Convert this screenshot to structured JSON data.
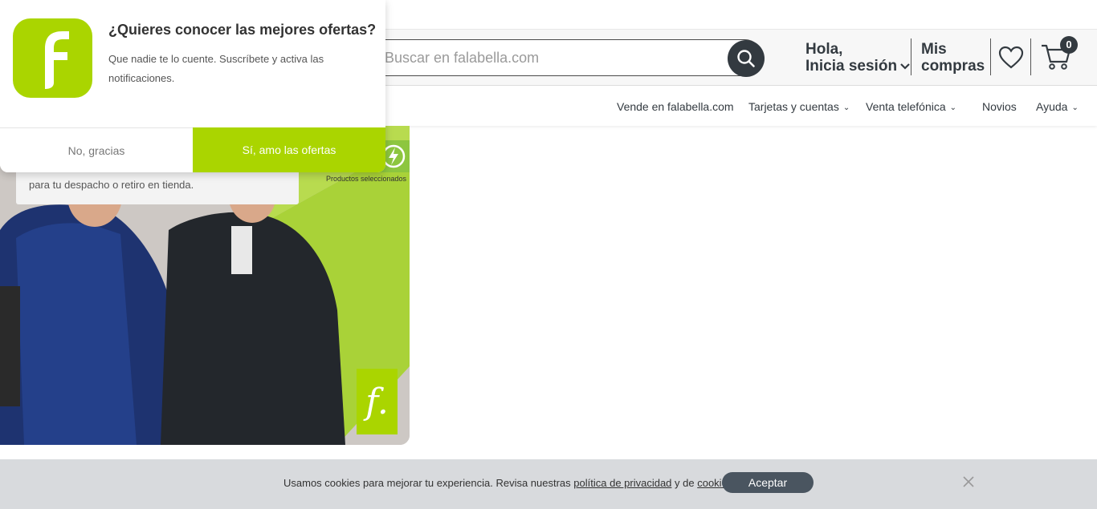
{
  "search": {
    "placeholder": "Buscar en falabella.com"
  },
  "account": {
    "greeting": "Hola,",
    "login_label": "Inicia sesión",
    "purchases_line1": "Mis",
    "purchases_line2": "compras"
  },
  "cart": {
    "count": "0"
  },
  "nav": {
    "items": [
      {
        "label": "Vende en falabella.com"
      },
      {
        "label": "Tarjetas y cuentas"
      },
      {
        "label": "Venta telefónica"
      },
      {
        "label": "Novios"
      },
      {
        "label": "Ayuda"
      }
    ]
  },
  "banner": {
    "promo_text": "para tu despacho o retiro en tienda.",
    "badge_label": "Productos seleccionados",
    "logo_letter": "f."
  },
  "popup": {
    "title": "¿Quieres conocer las mejores ofertas?",
    "body": "Que nadie te lo cuente. Suscríbete y activa las notificaciones.",
    "decline_label": "No, gracias",
    "accept_label": "Sí, amo las ofertas"
  },
  "cookies": {
    "text_before": "Usamos cookies para mejorar tu experiencia. Revisa nuestras ",
    "privacy_link": "política de privacidad",
    "text_middle": " y de ",
    "cookies_link": "cookies",
    "text_after": ".",
    "accept_label": "Aceptar"
  },
  "colors": {
    "brand_green": "#aad500",
    "dark": "#333a40",
    "cookie_bg": "#d8dadd"
  }
}
